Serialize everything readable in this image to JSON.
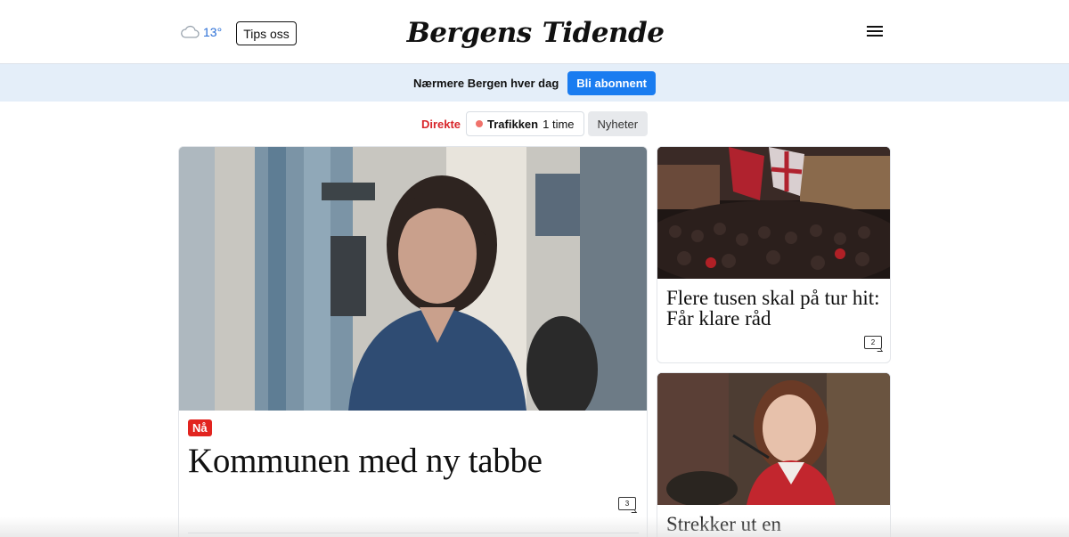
{
  "header": {
    "weather": {
      "icon": "cloud-icon",
      "temperature": "13°"
    },
    "tips_label": "Tips oss",
    "logo": {
      "left": "Bergens",
      "right": "Tidende",
      "emblem_icon": "city-crest-icon"
    },
    "menu_icon": "hamburger-menu-icon"
  },
  "promo": {
    "text": "Nærmere Bergen hver dag",
    "subscribe_label": "Bli abonnent",
    "background": "#e4eef9",
    "button_color": "#1a7cf0"
  },
  "chips": {
    "label": "Direkte",
    "live": {
      "title": "Trafikken",
      "time": "1 time",
      "dot_color": "#f0726b"
    },
    "news": "Nyheter"
  },
  "articles": [
    {
      "badge": "Nå",
      "headline": "Kommunen med ny tabbe",
      "comment_count": "3"
    },
    {
      "headline": "Flere tusen skal på tur hit: Får klare råd",
      "comment_count": "2"
    },
    {
      "headline": "Strekker ut en"
    }
  ]
}
